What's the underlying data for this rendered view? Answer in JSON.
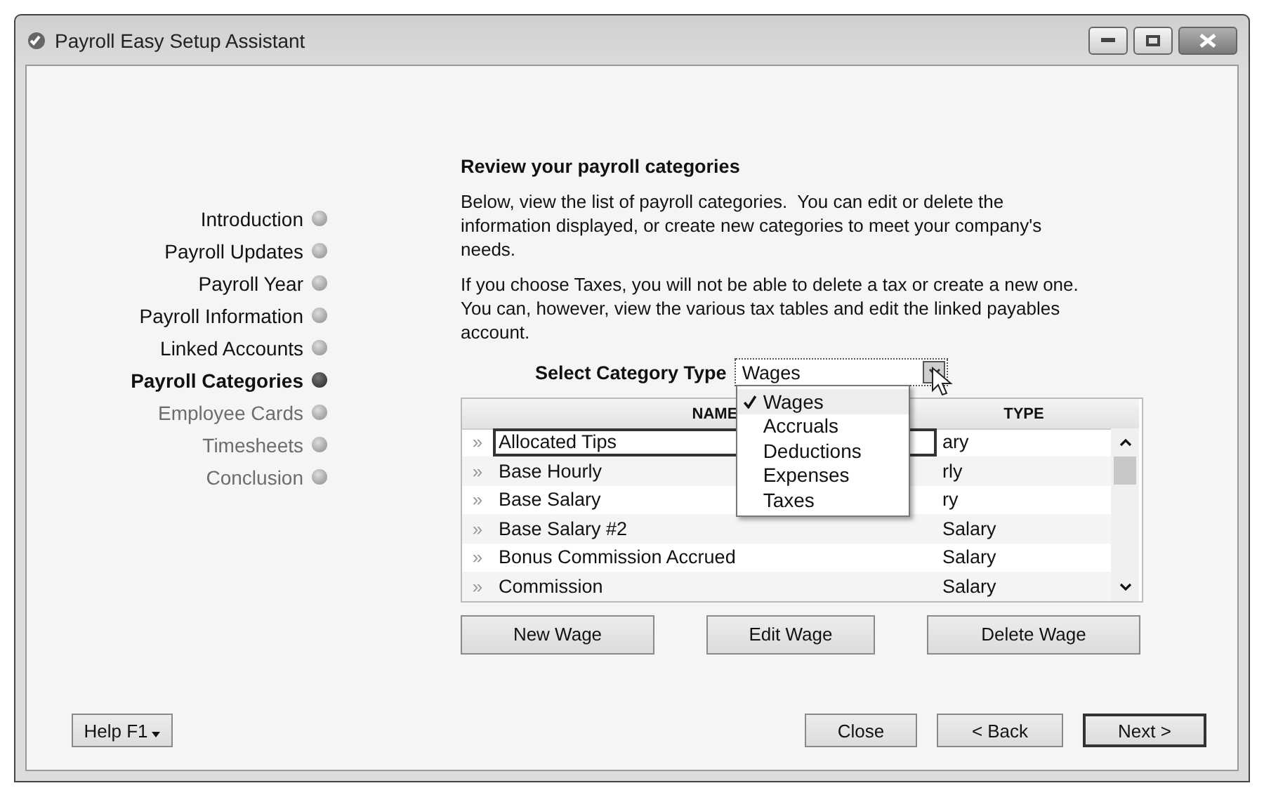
{
  "window": {
    "title": "Payroll Easy Setup Assistant"
  },
  "steps": [
    {
      "label": "Introduction",
      "current": false,
      "disabled": false
    },
    {
      "label": "Payroll Updates",
      "current": false,
      "disabled": false
    },
    {
      "label": "Payroll Year",
      "current": false,
      "disabled": false
    },
    {
      "label": "Payroll Information",
      "current": false,
      "disabled": false
    },
    {
      "label": "Linked Accounts",
      "current": false,
      "disabled": false
    },
    {
      "label": "Payroll Categories",
      "current": true,
      "disabled": false
    },
    {
      "label": "Employee Cards",
      "current": false,
      "disabled": true
    },
    {
      "label": "Timesheets",
      "current": false,
      "disabled": true
    },
    {
      "label": "Conclusion",
      "current": false,
      "disabled": true
    }
  ],
  "heading": "Review your payroll categories",
  "paragraphs": [
    "Below, view the list of payroll categories.  You can edit or delete the information displayed, or create new categories to meet your company's needs.",
    "If you choose Taxes, you will not be able to delete a tax or create a new one. You can, however, view the various tax tables and edit the linked payables account."
  ],
  "category_select": {
    "label": "Select Category Type",
    "value": "Wages",
    "expanded": true,
    "options": [
      {
        "label": "Wages",
        "selected": true
      },
      {
        "label": "Accruals",
        "selected": false
      },
      {
        "label": "Deductions",
        "selected": false
      },
      {
        "label": "Expenses",
        "selected": false
      },
      {
        "label": "Taxes",
        "selected": false
      }
    ]
  },
  "table": {
    "columns": [
      "NAME",
      "TYPE"
    ],
    "rows": [
      {
        "marker": "»",
        "name": "Allocated Tips",
        "type": "ary",
        "selected": true
      },
      {
        "marker": "»",
        "name": "Base Hourly",
        "type": "rly",
        "selected": false
      },
      {
        "marker": "»",
        "name": "Base Salary",
        "type": "ry",
        "selected": false
      },
      {
        "marker": "»",
        "name": "Base Salary #2",
        "type": "Salary",
        "selected": false
      },
      {
        "marker": "»",
        "name": "Bonus Commission Accrued",
        "type": "Salary",
        "selected": false
      },
      {
        "marker": "»",
        "name": "Commission",
        "type": "Salary",
        "selected": false
      }
    ]
  },
  "actions": [
    {
      "label": "New Wage"
    },
    {
      "label": "Edit Wage"
    },
    {
      "label": "Delete Wage"
    }
  ],
  "footer_left": {
    "label": "Help F1"
  },
  "footer_right": [
    {
      "label": "Close",
      "default": false
    },
    {
      "label": "< Back",
      "default": false
    },
    {
      "label": "Next >",
      "default": true
    }
  ]
}
